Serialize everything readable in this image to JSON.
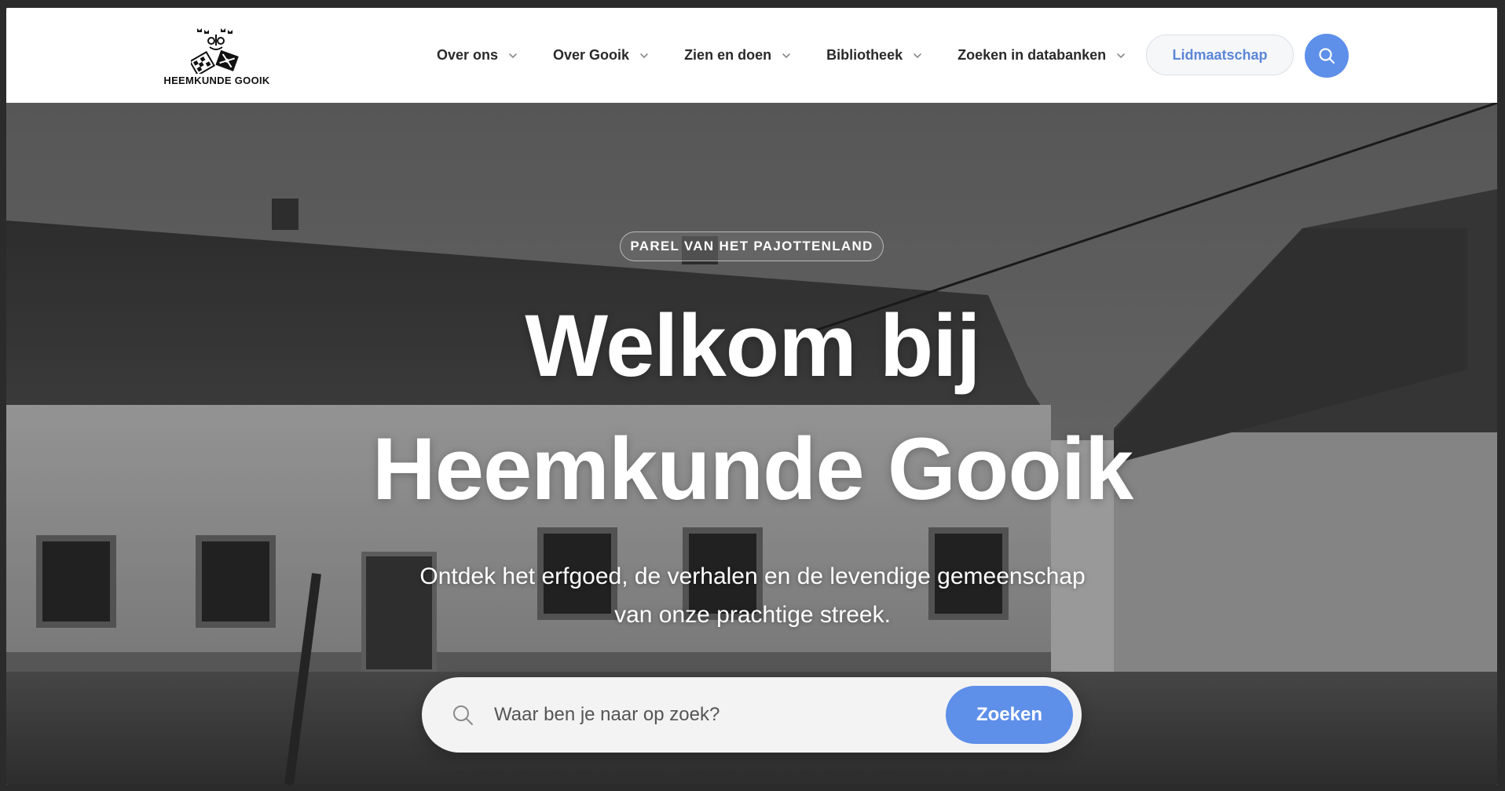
{
  "header": {
    "logo_text": "HEEMKUNDE GOOIK",
    "nav": [
      {
        "label": "Over ons",
        "icon": "chevron-down-icon"
      },
      {
        "label": "Over Gooik",
        "icon": "chevron-down-icon"
      },
      {
        "label": "Zien en doen",
        "icon": "chevron-down-icon"
      },
      {
        "label": "Bibliotheek",
        "icon": "chevron-down-icon"
      },
      {
        "label": "Zoeken in databanken",
        "icon": "chevron-down-icon"
      }
    ],
    "membership_label": "Lidmaatschap",
    "search_icon": "search-icon"
  },
  "hero": {
    "badge": "PAREL VAN HET PAJOTTENLAND",
    "title_line1": "Welkom bij",
    "title_line2": "Heemkunde Gooik",
    "subtitle_line1": "Ontdek het erfgoed, de verhalen en de levendige gemeenschap",
    "subtitle_line2": "van onze prachtige streek.",
    "search": {
      "placeholder": "Waar ben je naar op zoek?",
      "value": "",
      "button_label": "Zoeken"
    },
    "background": "black-and-white photo of farmhouse buildings"
  },
  "colors": {
    "accent": "#5e8fe9",
    "membership_text": "#5b86d8",
    "nav_text": "#2a2a2a"
  }
}
